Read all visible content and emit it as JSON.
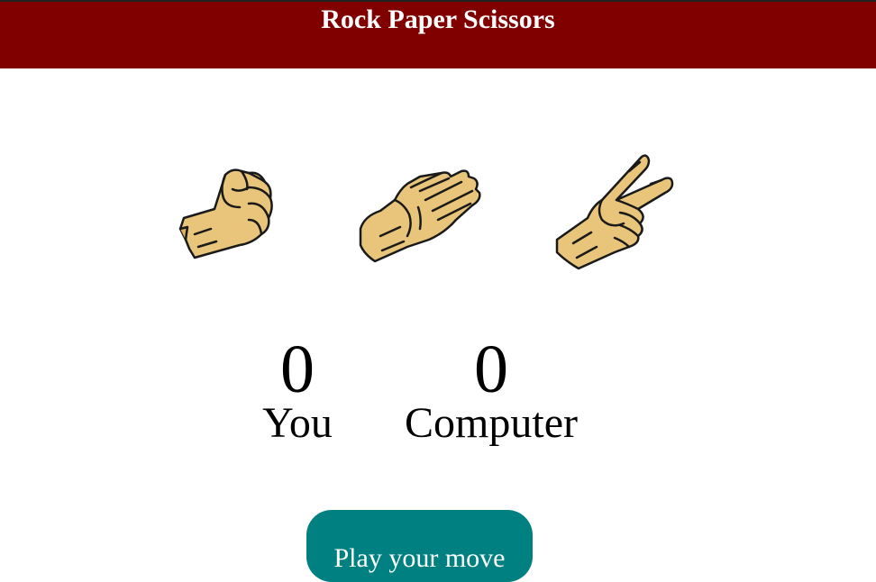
{
  "header": {
    "title": "Rock Paper Scissors",
    "background_color": "#800000"
  },
  "choices": [
    {
      "name": "rock",
      "icon": "rock-fist-icon"
    },
    {
      "name": "paper",
      "icon": "paper-open-hand-icon"
    },
    {
      "name": "scissors",
      "icon": "scissors-v-hand-icon"
    }
  ],
  "scoreboard": {
    "you": {
      "score": "0",
      "label": "You"
    },
    "computer": {
      "score": "0",
      "label": "Computer"
    }
  },
  "play_button": {
    "label": "Play your move",
    "color": "#008080"
  },
  "colors": {
    "skin": "#E8C57A",
    "outline": "#1a1a1a"
  }
}
